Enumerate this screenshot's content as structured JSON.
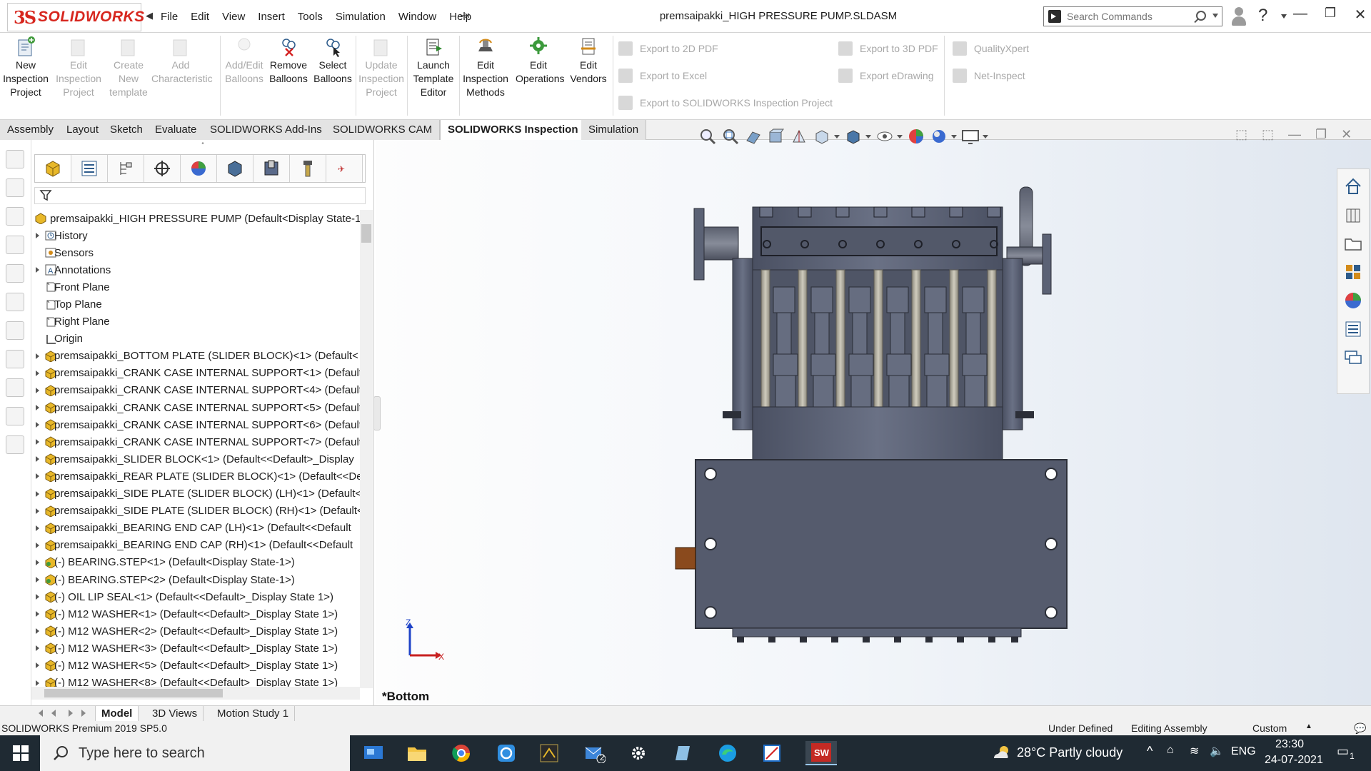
{
  "app": {
    "logo_ds": "3S",
    "logo_text": "SOLIDWORKS",
    "title": "premsaipakki_HIGH PRESSURE PUMP.SLDASM"
  },
  "menu": [
    "File",
    "Edit",
    "View",
    "Insert",
    "Tools",
    "Simulation",
    "Window",
    "Help"
  ],
  "search": {
    "placeholder": "Search Commands"
  },
  "toolbar": [
    {
      "label": "New\nInspection\nProject",
      "enabled": true
    },
    {
      "label": "Edit\nInspection\nProject",
      "enabled": false
    },
    {
      "label": "Create\nNew\ntemplate",
      "enabled": false
    },
    {
      "label": "Add\nCharacteristic",
      "enabled": false
    },
    {
      "label": "Add/Edit\nBalloons",
      "enabled": false
    },
    {
      "label": "Remove\nBalloons",
      "enabled": true
    },
    {
      "label": "Select\nBalloons",
      "enabled": true
    },
    {
      "label": "Update\nInspection\nProject",
      "enabled": false
    },
    {
      "label": "Launch\nTemplate\nEditor",
      "enabled": true
    },
    {
      "label": "Edit\nInspection\nMethods",
      "enabled": true
    },
    {
      "label": "Edit\nOperations",
      "enabled": true
    },
    {
      "label": "Edit\nVendors",
      "enabled": true
    }
  ],
  "export_buttons": [
    "Export to 2D PDF",
    "Export to Excel",
    "Export to SOLIDWORKS Inspection Project",
    "Export to 3D PDF",
    "Export eDrawing",
    "QualityXpert",
    "Net-Inspect"
  ],
  "tabs": [
    "Assembly",
    "Layout",
    "Sketch",
    "Evaluate",
    "SOLIDWORKS Add-Ins",
    "SOLIDWORKS CAM",
    "SOLIDWORKS Inspection",
    "Simulation"
  ],
  "active_tab": "SOLIDWORKS Inspection",
  "tree": {
    "root": "premsaipakki_HIGH PRESSURE PUMP  (Default<Display State-1>)",
    "items": [
      {
        "label": "History",
        "expand": true,
        "icon": "history"
      },
      {
        "label": "Sensors",
        "expand": false,
        "icon": "sensor"
      },
      {
        "label": "Annotations",
        "expand": true,
        "icon": "annotation"
      },
      {
        "label": "Front Plane",
        "expand": false,
        "icon": "plane"
      },
      {
        "label": "Top Plane",
        "expand": false,
        "icon": "plane"
      },
      {
        "label": "Right Plane",
        "expand": false,
        "icon": "plane"
      },
      {
        "label": "Origin",
        "expand": false,
        "icon": "origin"
      },
      {
        "label": "premsaipakki_BOTTOM PLATE (SLIDER BLOCK)<1> (Default<",
        "expand": true,
        "icon": "part"
      },
      {
        "label": "premsaipakki_CRANK CASE INTERNAL SUPPORT<1> (Default",
        "expand": true,
        "icon": "part"
      },
      {
        "label": "premsaipakki_CRANK CASE INTERNAL SUPPORT<4> (Default",
        "expand": true,
        "icon": "part"
      },
      {
        "label": "premsaipakki_CRANK CASE INTERNAL SUPPORT<5> (Default",
        "expand": true,
        "icon": "part"
      },
      {
        "label": "premsaipakki_CRANK CASE INTERNAL SUPPORT<6> (Default",
        "expand": true,
        "icon": "part"
      },
      {
        "label": "premsaipakki_CRANK CASE INTERNAL SUPPORT<7> (Default",
        "expand": true,
        "icon": "part"
      },
      {
        "label": "premsaipakki_SLIDER BLOCK<1> (Default<<Default>_Display",
        "expand": true,
        "icon": "part"
      },
      {
        "label": "premsaipakki_REAR PLATE (SLIDER BLOCK)<1> (Default<<De",
        "expand": true,
        "icon": "part"
      },
      {
        "label": "premsaipakki_SIDE PLATE (SLIDER BLOCK) (LH)<1> (Default<",
        "expand": true,
        "icon": "part"
      },
      {
        "label": "premsaipakki_SIDE PLATE (SLIDER BLOCK) (RH)<1> (Default<",
        "expand": true,
        "icon": "part"
      },
      {
        "label": "premsaipakki_BEARING END CAP (LH)<1> (Default<<Default",
        "expand": true,
        "icon": "part"
      },
      {
        "label": "premsaipakki_BEARING END CAP (RH)<1> (Default<<Default",
        "expand": true,
        "icon": "part"
      },
      {
        "label": "(-) BEARING.STEP<1> (Default<Display State-1>)",
        "expand": true,
        "icon": "subasm"
      },
      {
        "label": "(-) BEARING.STEP<2> (Default<Display State-1>)",
        "expand": true,
        "icon": "subasm"
      },
      {
        "label": "(-) OIL LIP SEAL<1> (Default<<Default>_Display State 1>)",
        "expand": true,
        "icon": "part"
      },
      {
        "label": "(-) M12 WASHER<1> (Default<<Default>_Display State 1>)",
        "expand": true,
        "icon": "part"
      },
      {
        "label": "(-) M12 WASHER<2> (Default<<Default>_Display State 1>)",
        "expand": true,
        "icon": "part"
      },
      {
        "label": "(-) M12 WASHER<3> (Default<<Default>_Display State 1>)",
        "expand": true,
        "icon": "part"
      },
      {
        "label": "(-) M12 WASHER<5> (Default<<Default>_Display State 1>)",
        "expand": true,
        "icon": "part"
      },
      {
        "label": "(-) M12 WASHER<8> (Default<<Default>_Display State 1>)",
        "expand": true,
        "icon": "part"
      }
    ]
  },
  "view_label": "*Bottom",
  "triad": {
    "z": "Z",
    "x": "X"
  },
  "bottom_tabs": [
    "Model",
    "3D Views",
    "Motion Study 1"
  ],
  "status": {
    "version": "SOLIDWORKS Premium 2019 SP5.0",
    "state": "Under Defined",
    "mode": "Editing Assembly",
    "units": "Custom"
  },
  "taskbar": {
    "search": "Type here to search",
    "weather": "28°C  Partly cloudy",
    "lang": "ENG",
    "time": "23:30",
    "date": "24-07-2021",
    "mail_badge": "2",
    "notif_badge": "1"
  },
  "colors": {
    "accent": "#d7261e",
    "part_fill": "#5b6275",
    "part_dark": "#2c2f38",
    "rod": "#a6a397",
    "copper": "#8a4a1d"
  }
}
